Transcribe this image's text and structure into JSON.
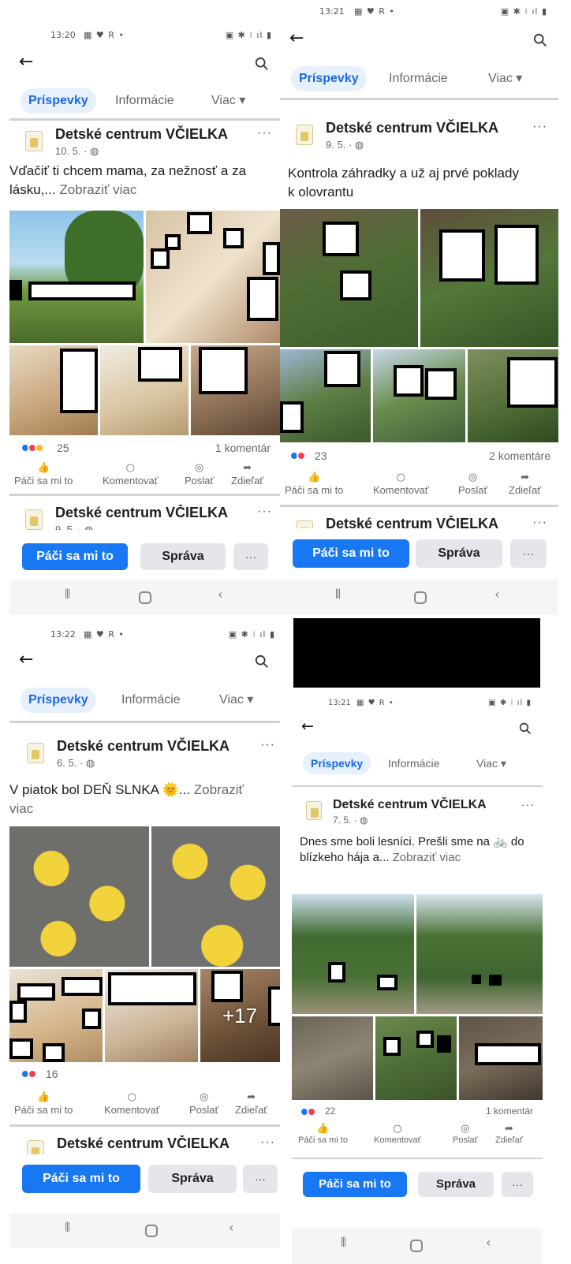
{
  "page_name": "Detské centrum VČIELKA",
  "tabs": {
    "posts": "Príspevky",
    "info": "Informácie",
    "more": "Viac ▾"
  },
  "actions": {
    "like": "Páči sa mi to",
    "comment": "Komentovať",
    "send": "Poslať",
    "share": "Zdieľať"
  },
  "bottom_bar": {
    "like": "Páči sa mi to",
    "message": "Správa",
    "more": "···"
  },
  "see_more": "Zobraziť viac",
  "more_dots": "···",
  "colors": {
    "accent": "#1877f2",
    "tab_active_bg": "#e7f0fd",
    "text": "#1c1e21",
    "muted": "#65676b"
  },
  "icons": {
    "back": "back-arrow-icon",
    "search": "search-icon",
    "like": "thumb-up-icon",
    "comment": "comment-bubble-icon",
    "send": "messenger-icon",
    "share": "share-arrow-icon"
  },
  "screens": [
    {
      "status": {
        "time": "13:20",
        "left_icons": "▦ ♥ R •",
        "right_icons": "▣ ✱ ⁝ ıl ▮"
      },
      "post": {
        "date": "10. 5. · ◍",
        "text": "Vďačiť ti chcem mama, za nežnosť a za lásku,...",
        "reactions": "25",
        "comments": "1 komentár"
      },
      "next_post": {
        "date": "9. 5. · ◍"
      }
    },
    {
      "status": {
        "time": "13:21",
        "left_icons": "▦ ♥ R •",
        "right_icons": "▣ ✱ ⁝ ıl ▮"
      },
      "post": {
        "date": "9. 5. · ◍",
        "text": "Kontrola záhradky a už aj prvé poklady k olovrantu",
        "reactions": "23",
        "comments": "2 komentáre"
      }
    },
    {
      "status": {
        "time": "13:22",
        "left_icons": "▦ ♥ R •",
        "right_icons": "▣ ✱ ⁝ ıl ▮"
      },
      "post": {
        "date": "6. 5. · ◍",
        "text": "V piatok bol DEŇ SLNKA 🌞...",
        "reactions": "16",
        "more_photos": "+17"
      }
    },
    {
      "status": {
        "time": "13:21",
        "left_icons": "▦ ♥ R •",
        "right_icons": "▣ ✱ ⁝ ıl ▮"
      },
      "post": {
        "date": "7. 5. · ◍",
        "text": "Dnes sme boli lesníci. Prešli sme na 🚲 do blízkeho hája a...",
        "reactions": "22",
        "comments": "1 komentár"
      }
    }
  ]
}
